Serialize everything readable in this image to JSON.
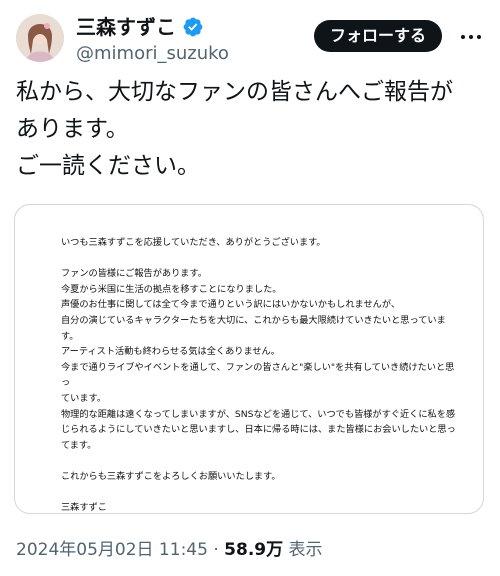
{
  "author": {
    "display_name": "三森すずこ",
    "handle": "@mimori_suzuko",
    "avatar_icon": "profile-photo"
  },
  "actions": {
    "follow_label": "フォローする",
    "more_icon": "more-dots-icon"
  },
  "tweet": {
    "text": "私から、大切なファンの皆さんへご報告が\nあります。\nご一読ください。"
  },
  "attachment": {
    "greeting": "いつも三森すずこを応援していただき、ありがとうございます。",
    "paragraph_lines": [
      "ファンの皆様にご報告があります。",
      "今夏から米国に生活の拠点を移すことになりました。",
      "声優のお仕事に関しては全て今まで通りという訳にはいかないかもしれませんが、",
      "自分の演じているキャラクターたちを大切に、これからも最大限続けていきたいと思っていま",
      "す。",
      "アーティスト活動も終わらせる気は全くありません。",
      "今まで通りライブやイベントを通して、ファンの皆さんと\"楽しい\"を共有していき続けたいと思っ",
      "ています。",
      "物理的な距離は遠くなってしまいますが、SNSなどを通じて、いつでも皆様がすぐ近くに私を感",
      "じられるようにしていきたいと思いますし、日本に帰る時には、また皆様にお会いしたいと思っ",
      "てます。"
    ],
    "closing": "これからも三森すずこをよろしくお願いいたします。",
    "signature": "三森すずこ"
  },
  "meta": {
    "timestamp": "2024年05月02日 11:45",
    "separator": " · ",
    "views_count": "58.9万",
    "views_label": " 表示"
  },
  "colors": {
    "verified": "#1d9bf0",
    "follow_button_bg": "#0f1419",
    "secondary_text": "#536471"
  }
}
